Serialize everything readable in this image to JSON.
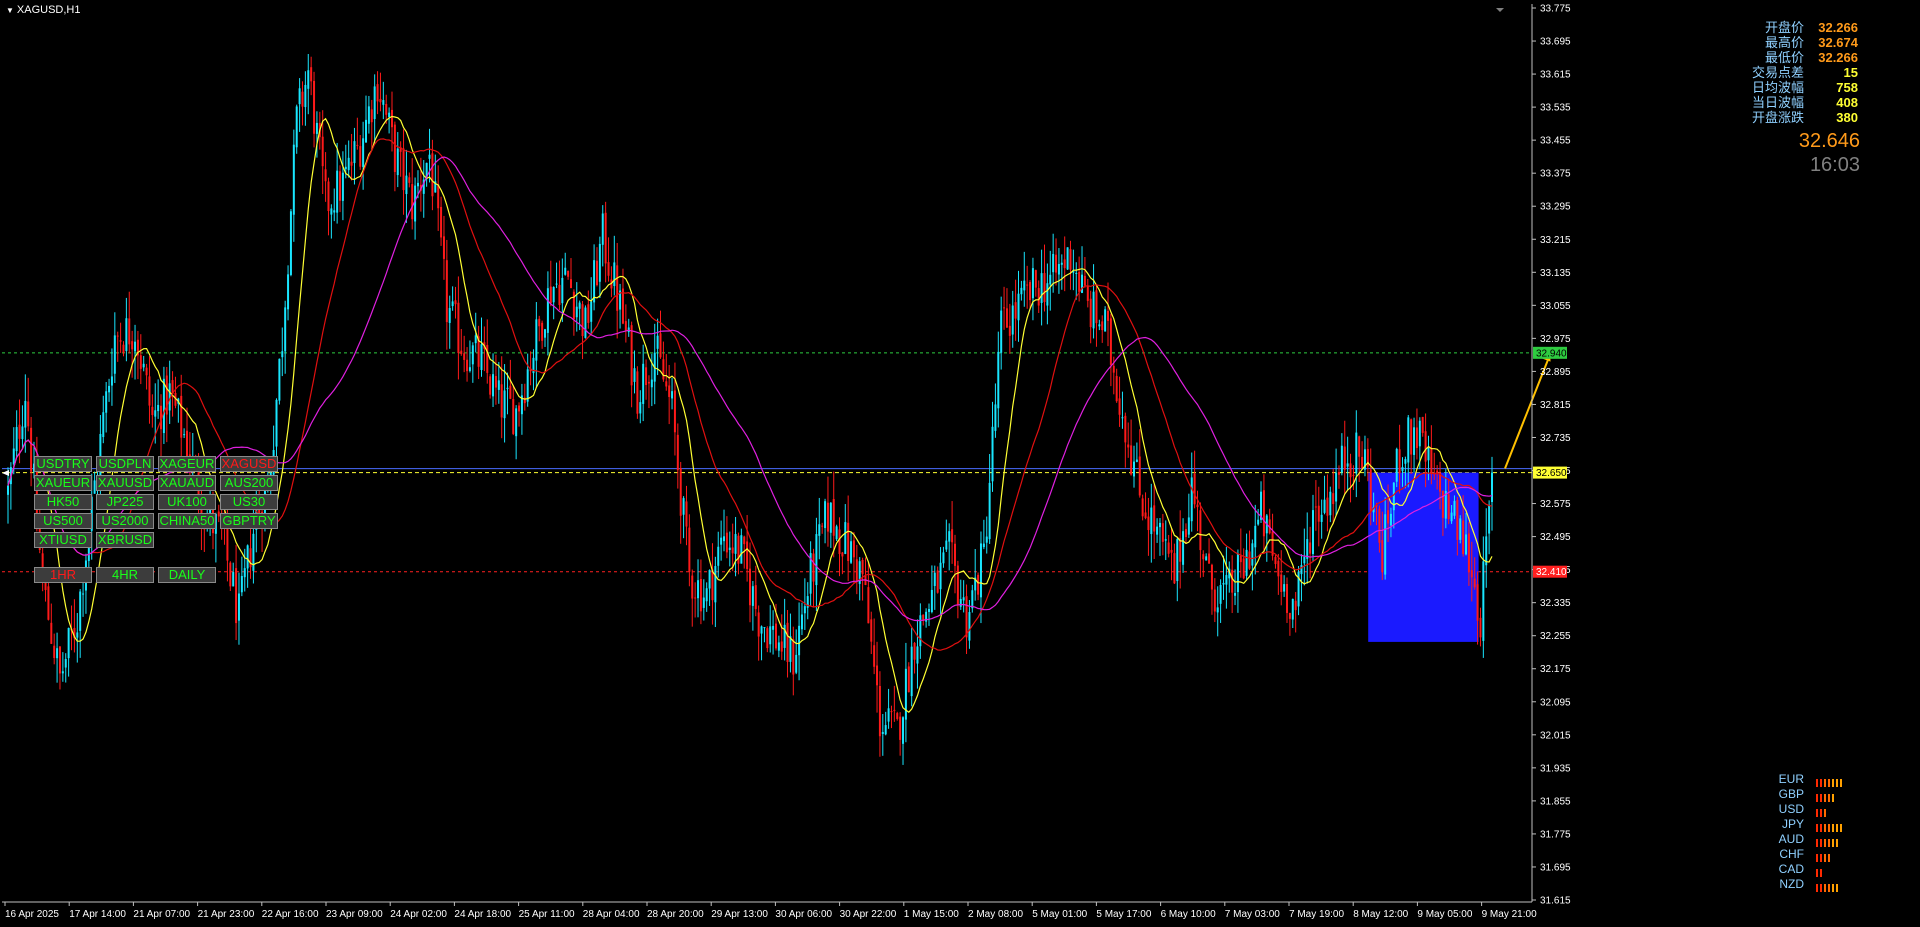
{
  "symbol_title": "XAGUSD,H1",
  "info_panel": [
    {
      "label": "开盘价",
      "value": "32.266",
      "color": "#ff9a1a"
    },
    {
      "label": "最高价",
      "value": "32.674",
      "color": "#ff9a1a"
    },
    {
      "label": "最低价",
      "value": "32.266",
      "color": "#ff9a1a"
    },
    {
      "label": "交易点差",
      "value": "15",
      "color": "#ffff33"
    },
    {
      "label": "日均波幅",
      "value": "758",
      "color": "#ffff33"
    },
    {
      "label": "当日波幅",
      "value": "408",
      "color": "#ffff33"
    },
    {
      "label": "开盘涨跌",
      "value": "380",
      "color": "#ffff33"
    }
  ],
  "bid_price": "32.646",
  "clock": "16:03",
  "symbol_buttons": [
    {
      "label": "USDTRY",
      "active": false
    },
    {
      "label": "USDPLN",
      "active": false
    },
    {
      "label": "XAGEUR",
      "active": false
    },
    {
      "label": "XAGUSD",
      "active": true
    },
    {
      "label": "XAUEUR",
      "active": false
    },
    {
      "label": "XAUUSD",
      "active": false
    },
    {
      "label": "XAUAUD",
      "active": false
    },
    {
      "label": "AUS200",
      "active": false
    },
    {
      "label": "HK50",
      "active": false
    },
    {
      "label": "JP225",
      "active": false
    },
    {
      "label": "UK100",
      "active": false
    },
    {
      "label": "US30",
      "active": false
    },
    {
      "label": "US500",
      "active": false
    },
    {
      "label": "US2000",
      "active": false
    },
    {
      "label": "CHINA50",
      "active": false
    },
    {
      "label": "GBPTRY",
      "active": false
    },
    {
      "label": "XTIUSD",
      "active": false
    },
    {
      "label": "XBRUSD",
      "active": false
    }
  ],
  "timeframe_buttons": [
    {
      "label": "1HR",
      "active": true
    },
    {
      "label": "4HR",
      "active": false
    },
    {
      "label": "DAILY",
      "active": false
    }
  ],
  "currency_strength": [
    {
      "name": "EUR",
      "bars": 7
    },
    {
      "name": "GBP",
      "bars": 5
    },
    {
      "name": "USD",
      "bars": 3
    },
    {
      "name": "JPY",
      "bars": 7
    },
    {
      "name": "AUD",
      "bars": 6
    },
    {
      "name": "CHF",
      "bars": 4
    },
    {
      "name": "CAD",
      "bars": 2
    },
    {
      "name": "NZD",
      "bars": 6
    }
  ],
  "colors": {
    "bull": "#19e6ff",
    "bear": "#ff1a1a",
    "ma_fast": "#ffff33",
    "ma_mid": "#e01010",
    "ma_slow": "#e020e0",
    "resistance": "#2ecc40",
    "support": "#ff2020",
    "current": "#ffff33",
    "box": "#1a1aff",
    "arrow": "#ffc000"
  },
  "chart_data": {
    "type": "candlestick",
    "title": "XAGUSD,H1",
    "y_ticks": [
      "33.775",
      "33.695",
      "33.615",
      "33.535",
      "33.455",
      "33.375",
      "33.295",
      "33.215",
      "33.135",
      "33.055",
      "32.975",
      "32.895",
      "32.815",
      "32.735",
      "32.655",
      "32.575",
      "32.495",
      "32.415",
      "32.335",
      "32.255",
      "32.175",
      "32.095",
      "32.015",
      "31.935",
      "31.855",
      "31.775",
      "31.695",
      "31.615"
    ],
    "ylim": [
      31.615,
      33.775
    ],
    "x_ticks": [
      "16 Apr 2025",
      "17 Apr 14:00",
      "21 Apr 07:00",
      "21 Apr 23:00",
      "22 Apr 16:00",
      "23 Apr 09:00",
      "24 Apr 02:00",
      "24 Apr 18:00",
      "25 Apr 11:00",
      "28 Apr 04:00",
      "28 Apr 20:00",
      "29 Apr 13:00",
      "30 Apr 06:00",
      "30 Apr 22:00",
      "1 May 15:00",
      "2 May 08:00",
      "5 May 01:00",
      "5 May 17:00",
      "6 May 10:00",
      "7 May 03:00",
      "7 May 19:00",
      "8 May 12:00",
      "9 May 05:00",
      "9 May 21:00"
    ],
    "levels": [
      {
        "name": "resistance",
        "price": 32.94,
        "label": "32.940"
      },
      {
        "name": "current",
        "price": 32.65,
        "label": "32.650"
      },
      {
        "name": "support",
        "price": 32.41,
        "label": "32.410"
      }
    ],
    "box": {
      "from": "8 May 12:00",
      "to": "9 May 21:00",
      "top": 32.65,
      "bottom": 32.24
    },
    "arrow": {
      "from_price": 32.66,
      "to_price": 32.95
    },
    "ohlc_anchors": [
      [
        0,
        32.6
      ],
      [
        6,
        32.85
      ],
      [
        12,
        32.38
      ],
      [
        18,
        32.15
      ],
      [
        24,
        32.3
      ],
      [
        30,
        32.62
      ],
      [
        37,
        32.98
      ],
      [
        44,
        33.0
      ],
      [
        50,
        32.78
      ],
      [
        56,
        32.84
      ],
      [
        62,
        32.72
      ],
      [
        68,
        32.55
      ],
      [
        74,
        32.5
      ],
      [
        80,
        32.3
      ],
      [
        86,
        32.55
      ],
      [
        90,
        32.6
      ],
      [
        95,
        32.98
      ],
      [
        100,
        33.5
      ],
      [
        104,
        33.62
      ],
      [
        110,
        33.3
      ],
      [
        116,
        33.35
      ],
      [
        122,
        33.45
      ],
      [
        128,
        33.6
      ],
      [
        134,
        33.42
      ],
      [
        140,
        33.3
      ],
      [
        146,
        33.42
      ],
      [
        152,
        33.05
      ],
      [
        158,
        32.95
      ],
      [
        164,
        32.92
      ],
      [
        170,
        32.82
      ],
      [
        176,
        32.8
      ],
      [
        182,
        32.95
      ],
      [
        188,
        33.1
      ],
      [
        194,
        33.12
      ],
      [
        200,
        33.0
      ],
      [
        206,
        33.22
      ],
      [
        212,
        33.05
      ],
      [
        218,
        32.85
      ],
      [
        224,
        32.95
      ],
      [
        230,
        32.8
      ],
      [
        236,
        32.4
      ],
      [
        242,
        32.35
      ],
      [
        248,
        32.5
      ],
      [
        254,
        32.45
      ],
      [
        260,
        32.3
      ],
      [
        266,
        32.25
      ],
      [
        272,
        32.2
      ],
      [
        278,
        32.4
      ],
      [
        284,
        32.55
      ],
      [
        290,
        32.48
      ],
      [
        296,
        32.4
      ],
      [
        302,
        32.05
      ],
      [
        308,
        32.02
      ],
      [
        314,
        32.25
      ],
      [
        320,
        32.35
      ],
      [
        326,
        32.45
      ],
      [
        332,
        32.3
      ],
      [
        338,
        32.45
      ],
      [
        344,
        33.0
      ],
      [
        350,
        33.05
      ],
      [
        356,
        33.1
      ],
      [
        362,
        33.12
      ],
      [
        368,
        33.18
      ],
      [
        374,
        33.05
      ],
      [
        380,
        33.0
      ],
      [
        386,
        32.8
      ],
      [
        392,
        32.6
      ],
      [
        398,
        32.5
      ],
      [
        404,
        32.4
      ],
      [
        410,
        32.62
      ],
      [
        416,
        32.38
      ],
      [
        422,
        32.35
      ],
      [
        428,
        32.42
      ],
      [
        434,
        32.55
      ],
      [
        440,
        32.4
      ],
      [
        446,
        32.32
      ],
      [
        452,
        32.55
      ],
      [
        458,
        32.6
      ],
      [
        464,
        32.7
      ],
      [
        470,
        32.68
      ],
      [
        476,
        32.45
      ],
      [
        482,
        32.7
      ],
      [
        488,
        32.75
      ],
      [
        494,
        32.62
      ],
      [
        500,
        32.55
      ],
      [
        506,
        32.45
      ],
      [
        510,
        32.3
      ],
      [
        514,
        32.62
      ]
    ]
  }
}
